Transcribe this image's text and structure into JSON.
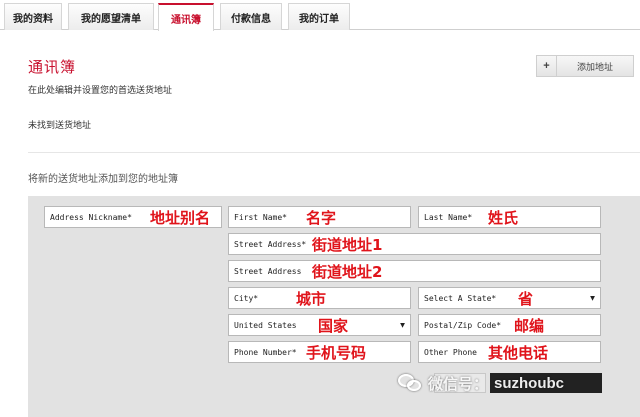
{
  "tabs": [
    {
      "label": "我的资料",
      "active": false
    },
    {
      "label": "我的愿望清单",
      "active": false
    },
    {
      "label": "通讯簿",
      "active": true
    },
    {
      "label": "付款信息",
      "active": false
    },
    {
      "label": "我的订单",
      "active": false
    }
  ],
  "header": {
    "title": "通讯簿",
    "description": "在此处编辑并设置您的首选送货地址",
    "empty_message": "未找到送货地址",
    "add_button": {
      "icon": "plus-icon",
      "plus": "+",
      "label": "添加地址"
    }
  },
  "section_title": "将新的送货地址添加到您的地址簿",
  "form": {
    "address_nickname": {
      "placeholder": "Address Nickname*",
      "annotation": "地址别名"
    },
    "first_name": {
      "placeholder": "First Name*",
      "annotation": "名字"
    },
    "last_name": {
      "placeholder": "Last Name*",
      "annotation": "姓氏"
    },
    "street_address_1": {
      "placeholder": "Street Address*",
      "annotation": "街道地址1"
    },
    "street_address_2": {
      "placeholder": "Street Address",
      "annotation": "街道地址2"
    },
    "city": {
      "placeholder": "City*",
      "annotation": "城市"
    },
    "state": {
      "value": "Select A State*",
      "annotation": "省",
      "icon": "dropdown-arrow-icon",
      "arrow": "▼"
    },
    "country": {
      "value": "United States",
      "annotation": "国家",
      "icon": "dropdown-arrow-icon",
      "arrow": "▼"
    },
    "postal_code": {
      "placeholder": "Postal/Zip Code*",
      "annotation": "邮编"
    },
    "phone_number": {
      "placeholder": "Phone Number*",
      "annotation": "手机号码"
    },
    "other_phone": {
      "placeholder": "Other Phone",
      "annotation": "其他电话"
    }
  },
  "actions": {
    "save_label": "",
    "dark_label": ""
  },
  "watermark": {
    "prefix": "微信号：",
    "account": "suzhoubc",
    "icon": "wechat-icon"
  },
  "colors": {
    "accent": "#c8102e",
    "annotation": "#e0141b",
    "panel": "#e2e2e2"
  }
}
